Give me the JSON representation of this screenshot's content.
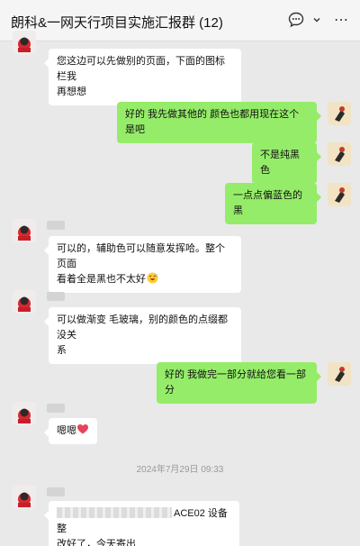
{
  "header": {
    "title": "朗科&一网天行项目实施汇报群 (12)",
    "icons": [
      "chat-bubble-icon",
      "chevron-down-icon",
      "more-icon"
    ],
    "more_glyph": "⋯"
  },
  "messages": [
    {
      "side": "left",
      "lines": [
        "您这边可以先做别的页面，下面的图标栏我",
        "再想想"
      ]
    },
    {
      "side": "right",
      "text": "好的 我先做其他的 颜色也都用现在这个是吧"
    },
    {
      "side": "right",
      "text": "不是纯黑色"
    },
    {
      "side": "right",
      "text": "一点点偏蓝色的黑"
    },
    {
      "side": "left",
      "lines": [
        "可以的，辅助色可以随意发挥哈。整个页面",
        "看着全是黑也不太好"
      ],
      "emoji": "grinning-sweat-emoji"
    },
    {
      "side": "left",
      "lines": [
        "可以做渐变 毛玻璃，别的颜色的点缀都没关",
        "系"
      ]
    },
    {
      "side": "right",
      "text": "好的 我做完一部分就给您看一部分"
    },
    {
      "side": "left",
      "text": "嗯嗯",
      "emoji": "heart-emoji"
    },
    {
      "side": "left",
      "lines": [
        "ACE02 设备整",
        "改好了，今天寄出"
      ],
      "redacted_prefix": true
    }
  ],
  "timestamp": "2024年7月29日 09:33",
  "colors": {
    "background": "#e9e9e9",
    "self_bubble": "#95ec69",
    "other_bubble": "#ffffff",
    "heart": "#e8435a"
  }
}
